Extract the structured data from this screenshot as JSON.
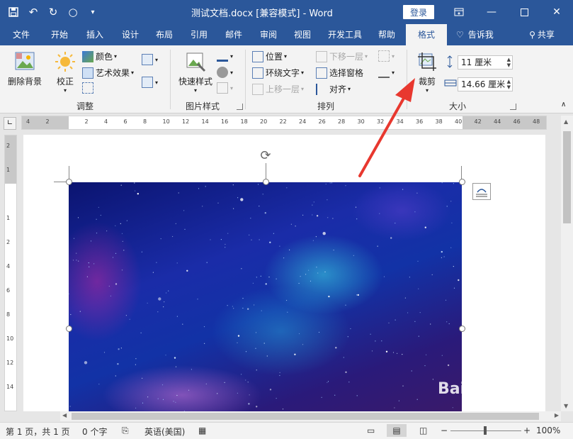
{
  "titlebar": {
    "title": "测试文档.docx [兼容模式] - Word",
    "login": "登录",
    "qat_icons": [
      "save-icon",
      "undo-icon",
      "redo-icon",
      "shape-icon",
      "customize-icon"
    ],
    "window_icons": [
      "ribbon-display-icon",
      "minimize-icon",
      "maximize-icon",
      "close-icon"
    ]
  },
  "tabs": [
    {
      "label": "文件"
    },
    {
      "label": "开始"
    },
    {
      "label": "插入"
    },
    {
      "label": "设计"
    },
    {
      "label": "布局"
    },
    {
      "label": "引用"
    },
    {
      "label": "邮件"
    },
    {
      "label": "审阅"
    },
    {
      "label": "视图"
    },
    {
      "label": "开发工具"
    },
    {
      "label": "帮助"
    },
    {
      "label": "格式"
    },
    {
      "label": "告诉我"
    },
    {
      "label": "共享"
    }
  ],
  "ribbon": {
    "adjust": {
      "remove_bg": "删除背景",
      "corrections": "校正",
      "color": "颜色",
      "artistic": "艺术效果",
      "label": "调整"
    },
    "picture_styles": {
      "quick_styles": "快速样式",
      "label": "图片样式"
    },
    "arrange": {
      "position": "位置",
      "wrap_text": "环绕文字",
      "bring_forward": "上移一层",
      "send_backward": "下移一层",
      "selection_pane": "选择窗格",
      "align": "对齐",
      "label": "排列"
    },
    "size": {
      "crop": "裁剪",
      "height": "11 厘米",
      "width": "14.66 厘米",
      "label": "大小"
    }
  },
  "ruler": {
    "h_ticks": [
      "4",
      "2",
      "",
      "2",
      "4",
      "6",
      "8",
      "10",
      "12",
      "14",
      "16",
      "18",
      "20",
      "22",
      "24",
      "26",
      "28",
      "30",
      "32",
      "34",
      "36",
      "38",
      "40",
      "42",
      "44",
      "46",
      "48"
    ],
    "v_ticks": [
      "2",
      "1",
      "",
      "1",
      "2",
      "4",
      "6",
      "8",
      "10",
      "12",
      "14"
    ]
  },
  "statusbar": {
    "page": "第 1 页，共 1 页",
    "words": "0 个字",
    "language": "英语(美国)",
    "zoom": "100%"
  },
  "watermark": "Baidu 经验"
}
